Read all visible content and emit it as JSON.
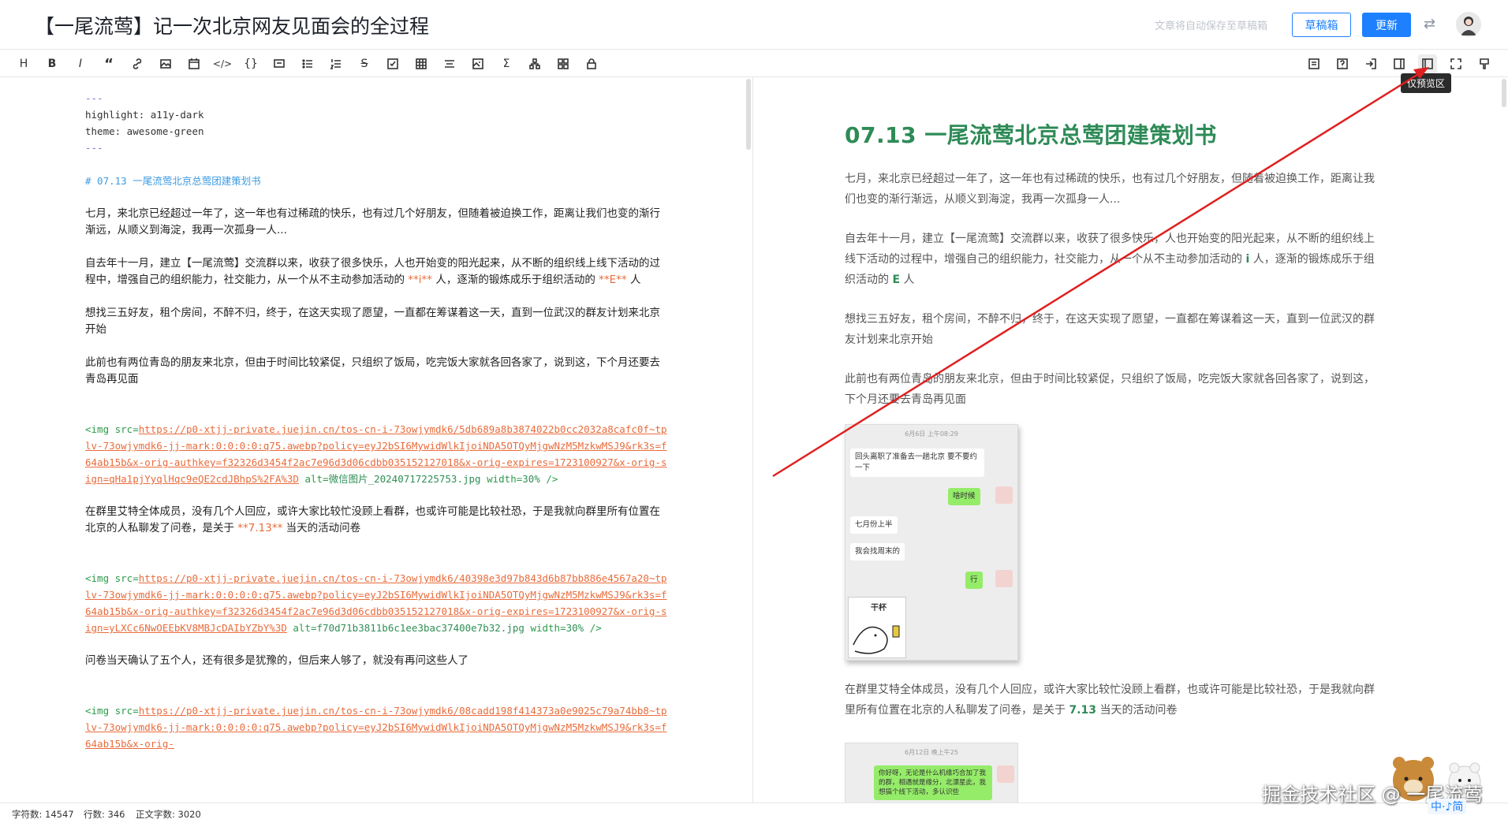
{
  "header": {
    "title": "【一尾流莺】记一次北京网友见面会的全过程",
    "autosave": "文章将自动保存至草稿箱",
    "draft_label": "草稿箱",
    "update_label": "更新",
    "exchange_icon": "exchange-icon"
  },
  "toolbar": {
    "tooltip": "仅预览区",
    "left_icons": [
      "heading",
      "bold",
      "italic",
      "quote",
      "link",
      "image",
      "file",
      "code",
      "code-block",
      "comment",
      "unordered-list",
      "ordered-list",
      "strikethrough",
      "task-list",
      "table",
      "align",
      "image-block",
      "formula",
      "graph",
      "grid",
      "lock"
    ],
    "right_icons": [
      "toc",
      "help",
      "export",
      "sync-scroll",
      "preview-only",
      "fullscreen",
      "theme"
    ]
  },
  "editor": {
    "frontmatter": [
      "---",
      "highlight: a11y-dark",
      "theme: awesome-green",
      "---"
    ],
    "heading": "# 07.13 一尾流莺北京总莺团建策划书",
    "p1": "七月，来北京已经超过一年了，这一年也有过稀疏的快乐，也有过几个好朋友，但随着被迫换工作，距离让我们也变的渐行渐远，从顺义到海淀，我再一次孤身一人...",
    "p2a": "自去年十一月，建立【一尾流莺】交流群以来，收获了很多快乐，人也开始变的阳光起来，从不断的组织线上线下活动的过程中，增强自己的组织能力，社交能力，从一个从不主动参加活动的 ",
    "p2_i": "**i**",
    "p2b": " 人，逐渐的锻炼成乐于组织活动的 ",
    "p2_e": "**E**",
    "p2c": " 人",
    "p3": "想找三五好友，租个房间，不醉不归，终于，在这天实现了愿望，一直都在筹谋着这一天，直到一位武汉的群友计划来北京开始",
    "p4": "此前也有两位青岛的朋友来北京，但由于时间比较紧促，只组织了饭局，吃完饭大家就各回各家了，说到这，下个月还要去青岛再见面",
    "img1_url": "https://p0-xtjj-private.juejin.cn/tos-cn-i-73owjymdk6/5db689a8b3874022b0cc2032a8cafc0f~tplv-73owjymdk6-jj-mark:0:0:0:0:q75.awebp?policy=eyJ2bSI6MywidWlkIjoiNDA5OTQyMjgwNzM5MzkwMSJ9&rk3s=f64ab15b&x-orig-authkey=f32326d3454f2ac7e96d3d06cdbb035152127018&x-orig-expires=1723100927&x-orig-sign=qHa1pjYyqlHqc9eQE2cdJBhpS%2FA%3D",
    "img1_alt": "微信图片_20240717225753.jpg",
    "img_width": "30%",
    "p5a": "在群里艾特全体成员，没有几个人回应，或许大家比较忙没顾上看群，也或许可能是比较社恐，于是我就向群里所有位置在北京的人私聊发了问卷，是关于 ",
    "p5_date": "**7.13**",
    "p5b": " 当天的活动问卷",
    "img2_url": "https://p0-xtjj-private.juejin.cn/tos-cn-i-73owjymdk6/40398e3d97b843d6b87bb886e4567a20~tplv-73owjymdk6-jj-mark:0:0:0:0:q75.awebp?policy=eyJ2bSI6MywidWlkIjoiNDA5OTQyMjgwNzM5MzkwMSJ9&rk3s=f64ab15b&x-orig-authkey=f32326d3454f2ac7e96d3d06cdbb035152127018&x-orig-expires=1723100927&x-orig-sign=yLXCc6NwOEEbKV8MBJcDAIbYZbY%3D",
    "img2_alt": "f70d71b3811b6c1ee3bac37400e7b32.jpg",
    "p6": "问卷当天确认了五个人，还有很多是犹豫的，但后来人够了，就没有再问这些人了",
    "img3_url": "https://p0-xtjj-private.juejin.cn/tos-cn-i-73owjymdk6/08cadd198f414373a0e9025c79a74bb8~tplv-73owjymdk6-jj-mark:0:0:0:0:q75.awebp?policy=eyJ2bSI6MywidWlkIjoiNDA5OTQyMjgwNzM5MzkwMSJ9&rk3s=f64ab15b&x-orig-"
  },
  "preview": {
    "h1": "07.13 一尾流莺北京总莺团建策划书",
    "p1": "七月，来北京已经超过一年了，这一年也有过稀疏的快乐，也有过几个好朋友，但随着被迫换工作，距离让我们也变的渐行渐远，从顺义到海淀，我再一次孤身一人...",
    "p2a": "自去年十一月，建立【一尾流莺】交流群以来，收获了很多快乐，人也开始变的阳光起来，从不断的组织线上线下活动的过程中，增强自己的组织能力，社交能力，从一个从不主动参加活动的 ",
    "p2_i": "i",
    "p2b": " 人，逐渐的锻炼成乐于组织活动的 ",
    "p2_e": "E",
    "p2c": " 人",
    "p3": "想找三五好友，租个房间，不醉不归，终于，在这天实现了愿望，一直都在筹谋着这一天，直到一位武汉的群友计划来北京开始",
    "p4": "此前也有两位青岛的朋友来北京，但由于时间比较紧促，只组织了饭局，吃完饭大家就各回各家了，说到这，下个月还要去青岛再见面",
    "chat1": {
      "time": "6月6日 上午08:29",
      "msg1": "回头离职了准备去一趟北京  要不要约一下",
      "msg2": "啥时候",
      "msg3": "七月份上半",
      "msg4": "我会找周末的",
      "msg5": "行",
      "sticker": "干杯"
    },
    "p5a": "在群里艾特全体成员，没有几个人回应，或许大家比较忙没顾上看群，也或许可能是比较社恐，于是我就向群里所有位置在北京的人私聊发了问卷，是关于 ",
    "p5_date": "7.13",
    "p5b": " 当天的活动问卷",
    "chat2": {
      "time": "6月12日 晚上午25",
      "msg1": "你好呀，无论是什么机缘巧合加了我的群，相遇就是缘分，北漂星此，我想搞个线下活动，多认识些"
    }
  },
  "status": {
    "chars": "字符数: 14547",
    "lines": "行数: 346",
    "body_chars": "正文字数: 3020"
  },
  "watermark": "掘金技术社区 @ 一尾流莺",
  "ime": "中·♪简",
  "colors": {
    "accent": "#1e80ff",
    "heading_green": "#2e8b57",
    "arrow": "#e02020"
  }
}
